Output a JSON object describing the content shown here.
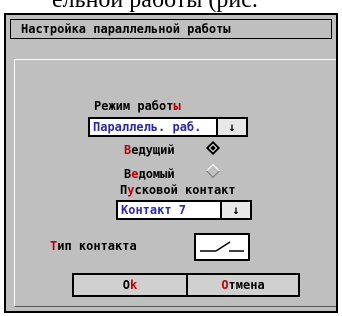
{
  "caption": "ельной работы (рис.",
  "dialog": {
    "title": "Настройка параллельной работы",
    "mode_label_prefix": "Режим работ",
    "mode_label_suffix": "ы",
    "mode_value": "Параллель. раб.",
    "arrow": "↓",
    "master_hot": "В",
    "master_rest": "едущий",
    "slave_pre": "В",
    "slave_hot": "е",
    "slave_rest": "домый",
    "start_pre": "П",
    "start_hot": "у",
    "start_rest": "сковой контакт",
    "contact_value": "Контакт 7",
    "contact_type_hot": "Т",
    "contact_type_rest": "ип контакта",
    "ok_pre": "O",
    "ok_hot": "k",
    "cancel_hot": "О",
    "cancel_rest": "тмена"
  },
  "colors": {
    "dialog_bg": "#bfbfbf",
    "hotkey": "#c00000",
    "dropdown_text": "#2a2aa8"
  }
}
